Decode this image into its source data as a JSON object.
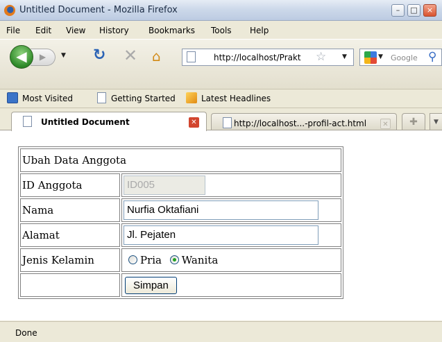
{
  "window": {
    "title": "Untitled Document - Mozilla Firefox",
    "minimize": "–",
    "maximize": "□",
    "close": "×"
  },
  "menu": [
    "File",
    "Edit",
    "View",
    "History",
    "Bookmarks",
    "Tools",
    "Help"
  ],
  "nav": {
    "url": "http://localhost/Prakt",
    "search_placeholder": "Google"
  },
  "bookmarks": [
    "Most Visited",
    "Getting Started",
    "Latest Headlines"
  ],
  "tabs": [
    {
      "label": "Untitled Document",
      "active": true
    },
    {
      "label": "http://localhost...-profil-act.html",
      "active": false
    }
  ],
  "form": {
    "heading": "Ubah Data Anggota",
    "id_label": "ID Anggota",
    "id_value": "ID005",
    "nama_label": "Nama",
    "nama_value": "Nurfia Oktafiani",
    "alamat_label": "Alamat",
    "alamat_value": "Jl. Pejaten",
    "gender_label": "Jenis Kelamin",
    "gender_options": [
      "Pria",
      "Wanita"
    ],
    "gender_selected": "Wanita",
    "submit_label": "Simpan"
  },
  "status": {
    "text": "Done"
  },
  "colors": {
    "accent": "#2e8a29",
    "close": "#d2462f"
  },
  "icons": [
    "firefox-logo-icon",
    "back-icon",
    "forward-icon",
    "reload-icon",
    "stop-icon",
    "home-icon",
    "page-icon",
    "star-icon",
    "google-icon",
    "search-icon",
    "rss-icon",
    "close-tab-icon",
    "new-tab-icon"
  ]
}
